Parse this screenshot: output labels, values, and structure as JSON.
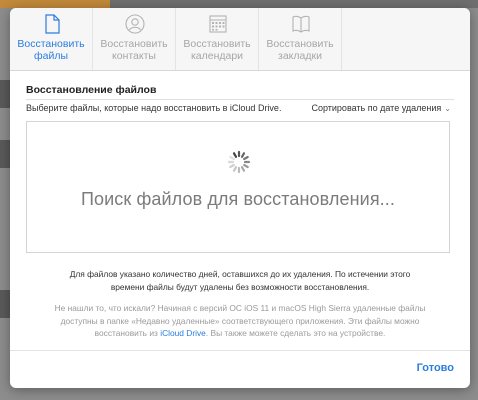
{
  "tabs": [
    {
      "label_line1": "Восстановить",
      "label_line2": "файлы",
      "icon": "document-icon",
      "active": true
    },
    {
      "label_line1": "Восстановить",
      "label_line2": "контакты",
      "icon": "contact-icon",
      "active": false
    },
    {
      "label_line1": "Восстановить",
      "label_line2": "календари",
      "icon": "calendar-icon",
      "active": false
    },
    {
      "label_line1": "Восстановить",
      "label_line2": "закладки",
      "icon": "book-icon",
      "active": false
    }
  ],
  "main": {
    "title": "Восстановление файлов",
    "subtitle": "Выберите файлы, которые надо восстановить в iCloud Drive.",
    "sort_label": "Сортировать по дате удаления",
    "searching_text": "Поиск файлов для восстановления...",
    "note": "Для файлов указано количество дней, оставшихся до их удаления. По истечении этого времени файлы будут удалены без возможности восстановления.",
    "hint_before": "Не нашли то, что искали? Начиная с версий ОС iOS 11 и macOS High Sierra удаленные файлы доступны в папке «Недавно удаленные» соответствующего приложения. Эти файлы можно восстановить из ",
    "hint_link": "iCloud Drive",
    "hint_after": ". Вы также можете сделать это на устройстве."
  },
  "footer": {
    "done_label": "Готово"
  },
  "colors": {
    "accent": "#2b7de0",
    "inactive": "#a6a6a6"
  }
}
